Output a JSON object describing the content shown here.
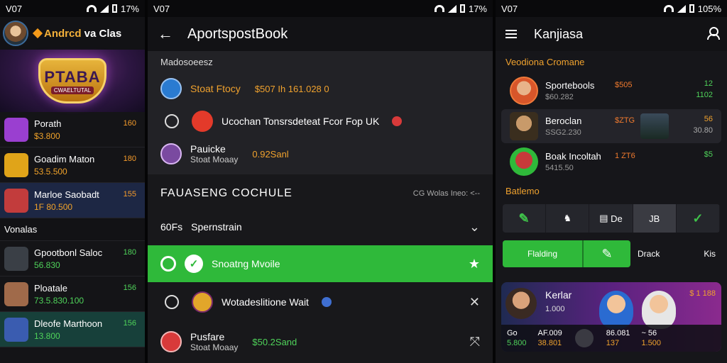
{
  "screen1": {
    "status": {
      "time": "V07",
      "battery": "17%"
    },
    "title": {
      "orange": "Andrcd",
      "white": "va Clas"
    },
    "banner": {
      "big": "PTABA",
      "small": "CWAELTUTAL"
    },
    "rows_top": [
      {
        "name": "Porath",
        "sub": "$3.800",
        "odd": "160",
        "color": "#9a3fd0"
      },
      {
        "name": "Goadim Maton",
        "sub": "53.5.500",
        "odd": "180",
        "color": "#e0a419"
      },
      {
        "name": "Marloe Saobadt",
        "sub": "1F 80.500",
        "odd": "155",
        "color": "#c23c3c"
      }
    ],
    "section": "Vonalas",
    "rows_bottom": [
      {
        "name": "Gpootbonl Saloc",
        "sub": "56.830",
        "odd": "180",
        "color": "#3a3f46"
      },
      {
        "name": "Ploatale",
        "sub": "73.5.830.100",
        "odd": "156",
        "color": "#a06a4a"
      },
      {
        "name": "Dleofe Marthoon",
        "sub": "13.800",
        "odd": "156",
        "color": "#3a5cb0"
      }
    ]
  },
  "screen2": {
    "status": {
      "time": "V07",
      "battery": "17%"
    },
    "title": "AportspostBook",
    "subhead": "Madosoeesz",
    "items": [
      {
        "text": "Stoat Ftocy",
        "amount": "$507 Ih 161.028 0",
        "color": "#2a7bd1"
      },
      {
        "text": "Ucochan Tonsrsdeteat Fcor Fop UK",
        "color": "#e33a2a"
      },
      {
        "text": "Pauicke",
        "small": "Stoat Moaay",
        "amount": "0.92Sanl",
        "color": "#7a4aa0"
      }
    ],
    "section_title": "FAUASENG COCHULE",
    "section_right": "CG  Wolas Ineo: <--",
    "row_sport": {
      "prefix": "60Fs",
      "text": "Spernstrain"
    },
    "row_active": {
      "text": "Snoatng Mvoile"
    },
    "row_item": {
      "text": "Wotadeslitione Wait",
      "color": "#e2a62a"
    },
    "row_last": {
      "text": "Pusfare",
      "small": "Stoat Moaay",
      "amount": "$50.2Sand",
      "color": "#d83a3a"
    }
  },
  "screen3": {
    "status": {
      "time": "V07",
      "battery": "105%"
    },
    "title": "Kanjiasa",
    "section1": "Veodiona Cromane",
    "cards": [
      {
        "name": "Sportebools",
        "sub": "$60.282",
        "odd": "$505",
        "odd2": "12",
        "odd2_low": "1102",
        "green": true,
        "color": "#d8562a"
      },
      {
        "name": "Beroclan",
        "sub": "SSG2.230",
        "odd": "$ZTG",
        "odd2": "56",
        "odd2_low": "30.80",
        "green": false,
        "color": "#5a4a2a",
        "img": true
      },
      {
        "name": "Boak Incoltah",
        "sub": "5415.50",
        "odd": "1 ZT6",
        "odd2": "$5",
        "odd2_low": "",
        "green": true,
        "color": "#2fb93a"
      }
    ],
    "section2": "Batlemo",
    "tabs": [
      "De",
      "JB"
    ],
    "buttons": {
      "first": "Flalding",
      "second": "✎",
      "label1": "Drack",
      "label2": "Kis"
    },
    "promo": {
      "title": "Kerlar",
      "sub": "1.000",
      "top_right": "$ 1 188",
      "cells": [
        {
          "top": "Go",
          "low": "5.800",
          "green": true
        },
        {
          "top": "AF.009",
          "low": "38.801",
          "green": false
        },
        {
          "top": "86.081",
          "low": "137",
          "green": false
        },
        {
          "top": "~ 56",
          "low": "1.500",
          "green": false
        }
      ]
    }
  }
}
